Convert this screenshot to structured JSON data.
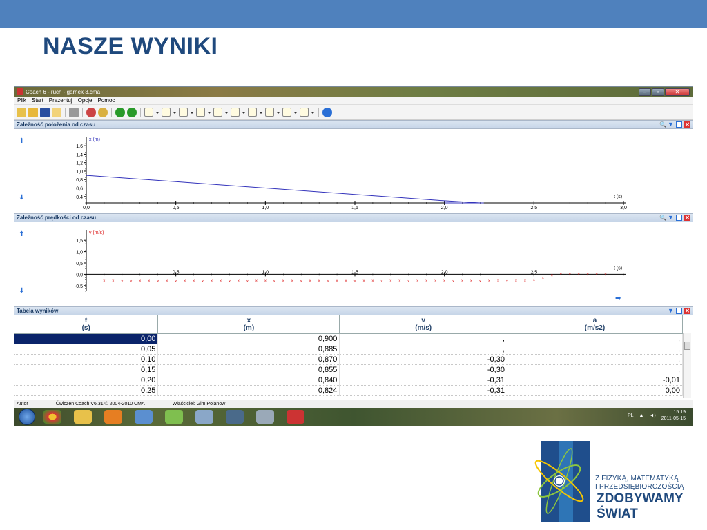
{
  "slide": {
    "title": "NASZE WYNIKI"
  },
  "window": {
    "title": "Coach 6 - ruch - garnek 3.cma"
  },
  "menu": [
    "Plik",
    "Start",
    "Prezentuj",
    "Opcje",
    "Pomoc"
  ],
  "panels": {
    "position": {
      "title": "Zależność położenia od czasu"
    },
    "velocity": {
      "title": "Zależność prędkości od czasu"
    },
    "table": {
      "title": "Tabela wyników"
    }
  },
  "chart_data": [
    {
      "type": "line",
      "title": "Zależność położenia od czasu",
      "xlabel": "t (s)",
      "ylabel": "x (m)",
      "xlim": [
        0,
        3.0
      ],
      "ylim": [
        0.25,
        1.7
      ],
      "xticks": [
        "0,0",
        "0,5",
        "1,0",
        "1,5",
        "2,0",
        "2,5",
        "3,0"
      ],
      "yticks": [
        "0,4",
        "0,6",
        "0,8",
        "1,0",
        "1,2",
        "1,4",
        "1,6"
      ],
      "x": [
        0,
        0.5,
        1.0,
        1.5,
        2.0,
        2.2
      ],
      "y": [
        0.9,
        0.75,
        0.6,
        0.45,
        0.3,
        0.25
      ],
      "color": "#3333bb"
    },
    {
      "type": "scatter",
      "title": "Zależność prędkości od czasu",
      "xlabel": "t (s)",
      "ylabel": "v (m/s)",
      "xlim": [
        0,
        3.0
      ],
      "ylim": [
        -0.75,
        1.75
      ],
      "xticks": [
        "0,5",
        "1,0",
        "1,5",
        "2,0",
        "2,5"
      ],
      "yticks": [
        "-0,5",
        "0,0",
        "0,5",
        "1,0",
        "1,5"
      ],
      "x": [
        0.1,
        0.15,
        0.2,
        0.25,
        0.3,
        0.35,
        0.4,
        0.45,
        0.5,
        0.55,
        0.6,
        0.65,
        0.7,
        0.75,
        0.8,
        0.85,
        0.9,
        0.95,
        1.0,
        1.05,
        1.1,
        1.15,
        1.2,
        1.25,
        1.3,
        1.35,
        1.4,
        1.45,
        1.5,
        1.55,
        1.6,
        1.65,
        1.7,
        1.75,
        1.8,
        1.85,
        1.9,
        1.95,
        2.0,
        2.05,
        2.1,
        2.15,
        2.2,
        2.25,
        2.3,
        2.35,
        2.4,
        2.45,
        2.5,
        2.55,
        2.6,
        2.65,
        2.7,
        2.75,
        2.8,
        2.85,
        2.9
      ],
      "y": [
        -0.3,
        -0.3,
        -0.31,
        -0.31,
        -0.3,
        -0.3,
        -0.31,
        -0.3,
        -0.31,
        -0.3,
        -0.3,
        -0.31,
        -0.3,
        -0.3,
        -0.31,
        -0.3,
        -0.31,
        -0.3,
        -0.3,
        -0.31,
        -0.3,
        -0.3,
        -0.31,
        -0.3,
        -0.3,
        -0.31,
        -0.3,
        -0.3,
        -0.31,
        -0.3,
        -0.3,
        -0.31,
        -0.3,
        -0.3,
        -0.31,
        -0.3,
        -0.3,
        -0.3,
        -0.3,
        -0.31,
        -0.3,
        -0.3,
        -0.31,
        -0.3,
        -0.3,
        -0.31,
        -0.3,
        -0.3,
        -0.25,
        -0.15,
        -0.05,
        0.0,
        0.0,
        0.0,
        0.0,
        0.0,
        0.0
      ],
      "color": "#dd2222"
    }
  ],
  "table": {
    "headers": [
      {
        "name": "t",
        "unit": "(s)"
      },
      {
        "name": "x",
        "unit": "(m)"
      },
      {
        "name": "v",
        "unit": "(m/s)"
      },
      {
        "name": "a",
        "unit": "(m/s2)"
      }
    ],
    "rows": [
      [
        "0,00",
        "0,900",
        ",",
        ","
      ],
      [
        "0,05",
        "0,885",
        ",",
        ","
      ],
      [
        "0,10",
        "0,870",
        "-0,30",
        ","
      ],
      [
        "0,15",
        "0,855",
        "-0,30",
        ","
      ],
      [
        "0,20",
        "0,840",
        "-0,31",
        "-0,01"
      ],
      [
        "0,25",
        "0,824",
        "-0,31",
        "0,00"
      ]
    ]
  },
  "status": {
    "author": "Autor",
    "exercise": "Ćwiczen Coach V6.31 © 2004-2010 CMA",
    "owner": "Właściciel: Gim Polanow"
  },
  "tray": {
    "lang": "PL",
    "time": "15:19",
    "date": "2011-05-15"
  },
  "logo": {
    "line1": "Z FIZYKĄ, MATEMATYKĄ",
    "line2": "I PRZEDSIĘBIORCZOŚCIĄ",
    "big1": "ZDOBYWAMY",
    "big2": "ŚWIAT"
  }
}
